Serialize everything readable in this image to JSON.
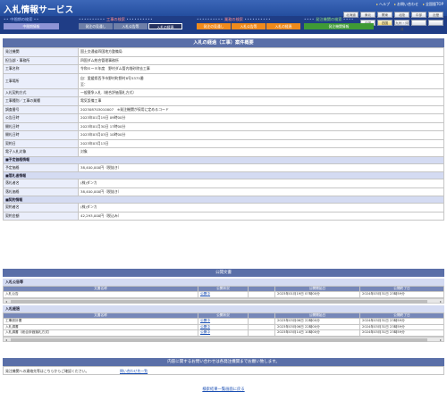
{
  "header": {
    "title": "入札情報サービス",
    "links": [
      "ヘルプ",
      "お問い合わせ",
      "全国版TOP"
    ]
  },
  "regions": {
    "row1": [
      "北海道",
      "東北",
      "関東",
      "北陸",
      "中部",
      "近畿"
    ],
    "row2": [
      "中国",
      "四国",
      "九州・沖縄",
      "",
      ""
    ],
    "active": "近畿"
  },
  "nav": {
    "groups": [
      {
        "title": "中間期の検索",
        "buttons": [
          "中間期情報"
        ]
      },
      {
        "title": "工事の検索",
        "buttons": [
          "発注の見通し",
          "入札公告等",
          "入札の経過"
        ]
      },
      {
        "title": "業務の検索",
        "buttons": [
          "発注の見通し",
          "入札公告等",
          "入札の経過"
        ]
      },
      {
        "title": "発注機関の検索",
        "buttons": [
          "発注機関情報"
        ]
      }
    ]
  },
  "detail": {
    "title": "入札の経過（工事）案件概要",
    "rows": [
      {
        "label": "発注機関",
        "value": "国土交通省四国地方整備局"
      },
      {
        "label": "担当部・事務所",
        "value": "四国ダム統合管理事務所"
      },
      {
        "label": "工事名称",
        "value": "令和６ー８年度　野村ダム管内堆砂除去工事"
      },
      {
        "label": "工事場所",
        "value": "自：愛媛県西予市野村町野村8号5375番\n至：",
        "tall": true
      },
      {
        "label": "入札契約方式",
        "value": "一般競争入札（総合評価落札方式）"
      },
      {
        "label": "工事種別／工事の業種",
        "value": "電気設備工事"
      },
      {
        "label": "調査番号",
        "value": "202308703010007　※発注機関が採用に定めるコード"
      },
      {
        "label": "公告日時",
        "value": "2023年01月19日 09時00分"
      },
      {
        "label": "開札日時",
        "value": "2023年01月30日 17時00分"
      },
      {
        "label": "開札日時",
        "value": "2023年03月03日 10時00分"
      },
      {
        "label": "契約日",
        "value": "2023年03月13日"
      },
      {
        "label": "電子入札対象",
        "value": "対象"
      }
    ],
    "sections": [
      {
        "title": "■予定価格情報",
        "rows": [
          {
            "label": "予定価格",
            "value": "38,400,000円（税抜き）"
          }
        ]
      },
      {
        "title": "■落札者情報",
        "rows": [
          {
            "label": "落札者名",
            "value": "(株)ダンカ"
          },
          {
            "label": "落札価格",
            "value": "38,400,000円（税抜き）"
          }
        ]
      },
      {
        "title": "■契約情報",
        "rows": [
          {
            "label": "契約者名",
            "value": "(株)ダンカ"
          },
          {
            "label": "契約金額",
            "value": "42,293,000円（税込み）"
          }
        ]
      }
    ]
  },
  "notices": {
    "title": "公開文書",
    "koukoku": {
      "heading": "入札公告等",
      "columns": [
        "文書名称",
        "",
        "公開状況",
        "公開開始日",
        "公開終了日"
      ],
      "rows": [
        {
          "name": "入札公告",
          "link": "公開中",
          "status": "",
          "start": "2023年01月19日 07時00分",
          "end": "2024年03月31日 23時59分"
        }
      ]
    },
    "keika": {
      "heading": "入札経過",
      "columns": [
        "文書名称",
        "",
        "公開状況",
        "公開開始日",
        "公開終了日"
      ],
      "rows": [
        {
          "name": "工事設計書",
          "link": "公開中",
          "status": "",
          "start": "2023年03月06日 22時00分",
          "end": "2024年03月31日 23時59分"
        },
        {
          "name": "入札調書",
          "link": "公開中",
          "status": "",
          "start": "2023年03月06日 22時00分",
          "end": "2024年03月31日 23時59分"
        },
        {
          "name": "入札調書（総合評価落札方式）",
          "link": "公開中",
          "status": "",
          "start": "2023年03月14日 10時00分",
          "end": "2024年03月31日 23時59分"
        }
      ]
    }
  },
  "contact": {
    "title": "内容に関するお問い合わせは各発注機関までお願い致します。",
    "text": "発注機関への連絡先等はこちらからご確認ください。",
    "link": "問い合わせ先一覧"
  },
  "footer": {
    "back": "検索結果一覧画面に戻る"
  },
  "colors": {
    "header": "#244e9f",
    "navBand": "#1f3d86",
    "panelBar": "#5a6fa8",
    "labelCell": "#eaeefb",
    "orange": "#f08a1b",
    "green": "#3f9a35"
  }
}
